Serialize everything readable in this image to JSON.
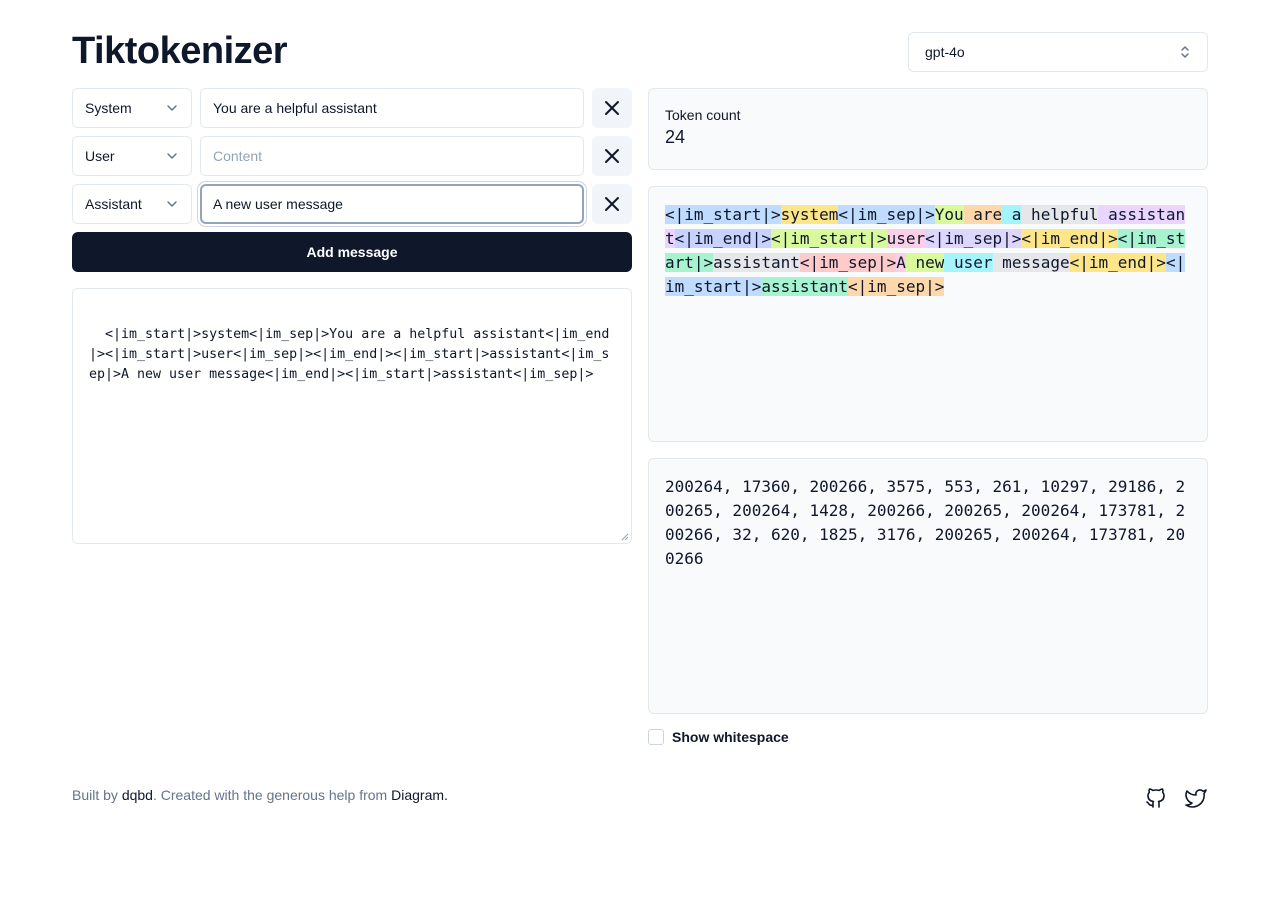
{
  "app": {
    "title": "Tiktokenizer"
  },
  "model_select": {
    "value": "gpt-4o",
    "icon": "chevron-up-down-icon"
  },
  "messages": [
    {
      "role": "System",
      "content": "You are a helpful assistant",
      "placeholder": "Content"
    },
    {
      "role": "User",
      "content": "",
      "placeholder": "Content"
    },
    {
      "role": "Assistant",
      "content": "A new user message",
      "placeholder": "Content"
    }
  ],
  "add_message_label": "Add message",
  "raw_text": "<|im_start|>system<|im_sep|>You are a helpful assistant<|im_end|><|im_start|>user<|im_sep|><|im_end|><|im_start|>assistant<|im_sep|>A new user message<|im_end|><|im_start|>assistant<|im_sep|>",
  "token_count": {
    "label": "Token count",
    "value": "24"
  },
  "tokens": [
    {
      "text": "<|im_start|>",
      "color": "#bfdbfe"
    },
    {
      "text": "system",
      "color": "#fde68a"
    },
    {
      "text": "<|im_sep|>",
      "color": "#bfdbfe"
    },
    {
      "text": "You",
      "color": "#d9f99d"
    },
    {
      "text": " are",
      "color": "#fed7aa"
    },
    {
      "text": " a",
      "color": "#a5f3fc"
    },
    {
      "text": " helpful",
      "color": "#e5e7eb"
    },
    {
      "text": " assistant",
      "color": "#e9d5ff"
    },
    {
      "text": "<|im_end|>",
      "color": "#c7d2fe"
    },
    {
      "text": "<|im_start|>",
      "color": "#d9f99d"
    },
    {
      "text": "user",
      "color": "#fbcfe8"
    },
    {
      "text": "<|im_sep|>",
      "color": "#ddd6fe"
    },
    {
      "text": "<|im_end|>",
      "color": "#fde68a"
    },
    {
      "text": "<|im_start|>",
      "color": "#a7f3d0"
    },
    {
      "text": "assistant",
      "color": "#e5e7eb"
    },
    {
      "text": "<|im_sep|>",
      "color": "#fecaca"
    },
    {
      "text": "A",
      "color": "#fbcfe8"
    },
    {
      "text": " new",
      "color": "#d9f99d"
    },
    {
      "text": " user",
      "color": "#a5f3fc"
    },
    {
      "text": " message",
      "color": "#e5e7eb"
    },
    {
      "text": "<|im_end|>",
      "color": "#fde68a"
    },
    {
      "text": "<|im_start|>",
      "color": "#bfdbfe"
    },
    {
      "text": "assistant",
      "color": "#a7f3d0"
    },
    {
      "text": "<|im_sep|>",
      "color": "#fed7aa"
    }
  ],
  "token_ids": "200264, 17360, 200266, 3575, 553, 261, 10297, 29186, 200265, 200264, 1428, 200266, 200265, 200264, 173781, 200266, 32, 620, 1825, 3176, 200265, 200264, 173781, 200266",
  "show_whitespace": {
    "label": "Show whitespace",
    "checked": false
  },
  "footer": {
    "prefix": "Built by ",
    "author": "dqbd",
    "middle": ". Created with the generous help from ",
    "helper": "Diagram",
    "suffix": "."
  },
  "colors": {
    "primary": "#0f172a",
    "muted": "#64748b",
    "border": "#e2e8f0",
    "card_bg": "#f8fafc"
  }
}
